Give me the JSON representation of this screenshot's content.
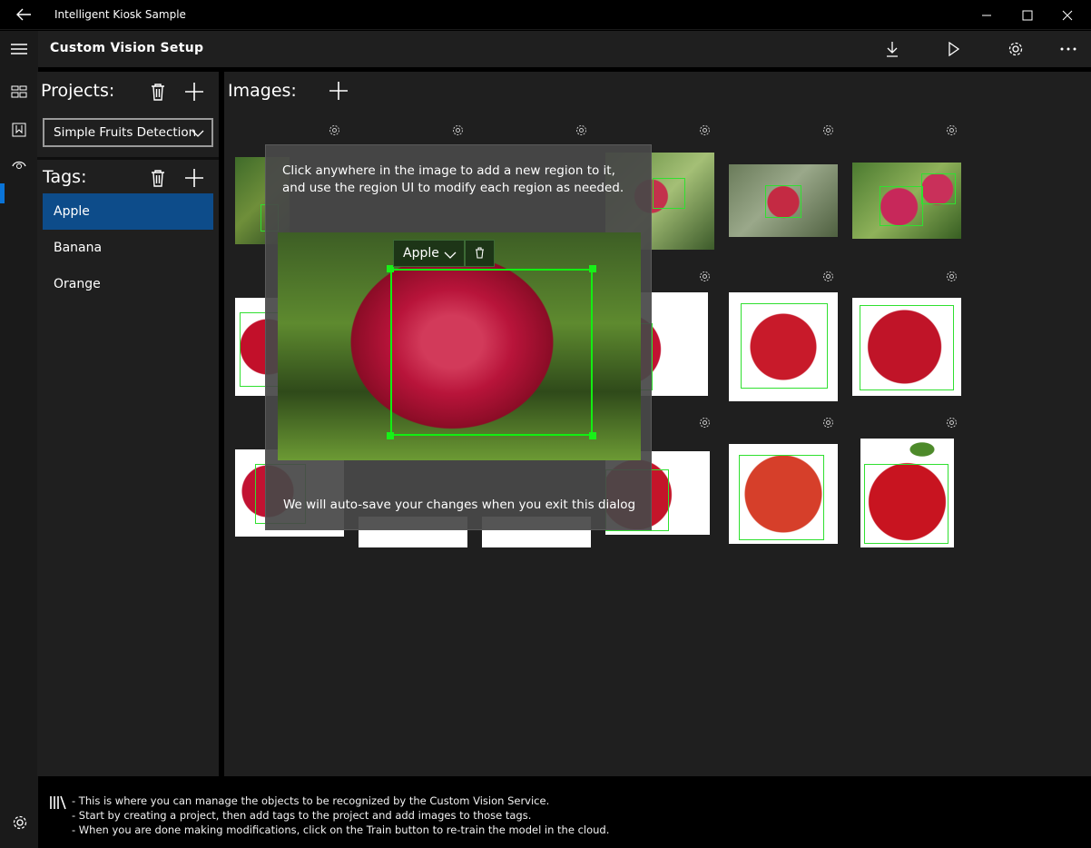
{
  "window": {
    "app_title": "Intelligent Kiosk Sample"
  },
  "header": {
    "page_title": "Custom Vision Setup"
  },
  "projects": {
    "label": "Projects:",
    "selected": "Simple Fruits Detection"
  },
  "tags": {
    "label": "Tags:",
    "items": [
      {
        "label": "Apple",
        "selected": true
      },
      {
        "label": "Banana",
        "selected": false
      },
      {
        "label": "Orange",
        "selected": false
      }
    ]
  },
  "images": {
    "label": "Images:"
  },
  "dialog": {
    "instructions": "Click anywhere in the image to add a new region to it, and use the region UI to modify each region as needed.",
    "region_tag": "Apple",
    "footer": "We will auto-save your changes when you exit this dialog"
  },
  "bottom_help": {
    "lines": [
      "- This is where you can manage the objects to be recognized by the Custom Vision Service.",
      "- Start by creating a project, then add tags to the project and add images to those tags.",
      "- When you are done making modifications, click on the Train button to re-train the model in the cloud."
    ]
  },
  "colors": {
    "accent": "#0a74d8",
    "selected_tag": "#0d4c8a",
    "region": "#12ee12"
  }
}
